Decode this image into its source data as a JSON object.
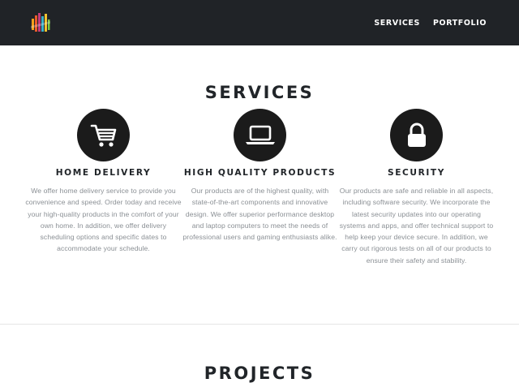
{
  "nav": {
    "logo_icon": "prism-logo-icon",
    "links": [
      "SERVICES",
      "PORTFOLIO"
    ]
  },
  "services": {
    "title": "SERVICES",
    "items": [
      {
        "icon": "shopping-cart-icon",
        "title": "HOME DELIVERY",
        "text": "We offer home delivery service to provide you convenience and speed. Order today and receive your high-quality products in the comfort of your own home. In addition, we offer delivery scheduling options and specific dates to accommodate your schedule."
      },
      {
        "icon": "laptop-icon",
        "title": "HIGH QUALITY PRODUCTS",
        "text": "Our products are of the highest quality, with state-of-the-art components and innovative design. We offer superior performance desktop and laptop computers to meet the needs of professional users and gaming enthusiasts alike."
      },
      {
        "icon": "lock-icon",
        "title": "SECURITY",
        "text": "Our products are safe and reliable in all aspects, including software security. We incorporate the latest security updates into our operating systems and apps, and offer technical support to help keep your device secure. In addition, we carry out rigorous tests on all of our products to ensure their safety and stability."
      }
    ]
  },
  "projects": {
    "title": "PROJECTS"
  },
  "colors": {
    "navbar_bg": "#202327",
    "icon_circle": "#1b1b1b",
    "heading": "#212529",
    "body_text": "#8a8f94"
  }
}
